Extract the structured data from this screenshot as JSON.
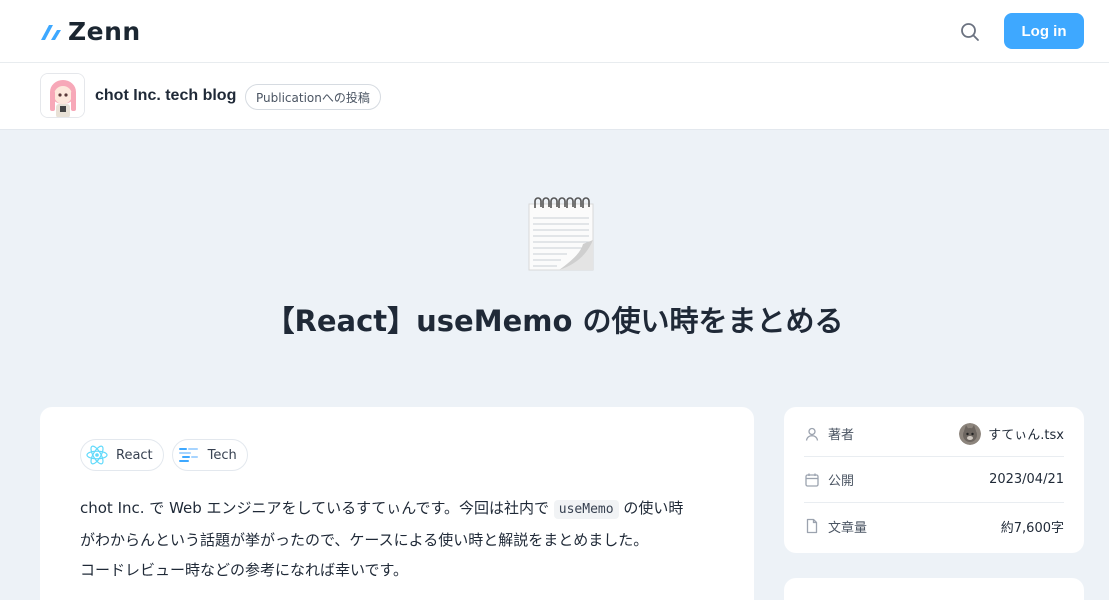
{
  "header": {
    "logo_text": "Zenn",
    "login_label": "Log in",
    "icons": {
      "search": "search-icon",
      "logo": "zenn-logo-icon"
    },
    "accent_color": "#3ea8ff"
  },
  "publication": {
    "name": "chot Inc. tech blog",
    "chip_label": "Publicationへの投稿"
  },
  "article": {
    "emoji": "spiral-notepad-emoji",
    "title": "【React】useMemo の使い時をまとめる",
    "topics": [
      {
        "label": "React",
        "icon": "react-icon"
      },
      {
        "label": "Tech",
        "icon": "tech-icon"
      }
    ],
    "body": {
      "line1_pre": "chot Inc. で Web エンジニアをしているすてぃんです。今回は社内で ",
      "line1_code": "useMemo",
      "line1_post": " の使い時",
      "line2": "がわからんという話題が挙がったので、ケースによる使い時と解説をまとめました。",
      "line3": "コードレビュー時などの参考になれば幸いです。"
    }
  },
  "info": {
    "author_label": "著者",
    "author_name": "すてぃん.tsx",
    "published_label": "公開",
    "published_date": "2023/04/21",
    "length_label": "文章量",
    "length_value": "約7,600字"
  }
}
